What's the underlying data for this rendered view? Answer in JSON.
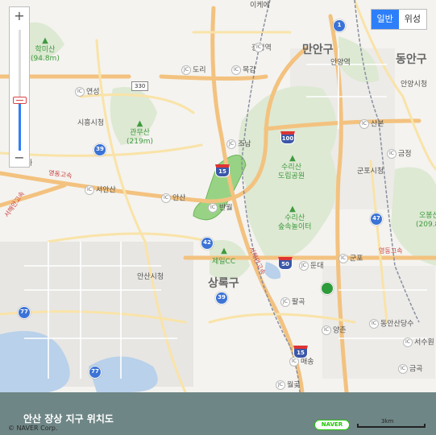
{
  "map_labels": {
    "district_large": [
      "만안구",
      "동안구",
      "상록구"
    ],
    "peaks": [
      {
        "name": "학미산",
        "elev": "(94.8m)"
      },
      {
        "name": "관무산",
        "elev": "(219m)"
      },
      {
        "name": "오봉산",
        "elev": "(209.8)"
      }
    ],
    "parks": [
      "수리산\n도립공원",
      "수리산\n숲속놀이터",
      "제일CC"
    ],
    "places": [
      "이케에",
      "광명역",
      "안양역",
      "안양시청",
      "시흥시청",
      "군포시청",
      "안산시청",
      "산본",
      "금정",
      "당정",
      "목감",
      "조남",
      "도리",
      "연성",
      "서안산",
      "안산",
      "반월",
      "군포",
      "둔대",
      "팔곡",
      "양촌",
      "동안산당수",
      "서수원",
      "금곡",
      "매송",
      "월곶"
    ],
    "ic_labels": [
      "IC 광명역",
      "JC 도리",
      "IC 목감",
      "IC 연성",
      "JC 조남",
      "IC 서안산",
      "IC 안산",
      "IC 산본",
      "IC 금정",
      "JC 둔대",
      "IC 군포",
      "JC 팔곡",
      "IC 양촌",
      "IC 동안산당수",
      "IC 서수원",
      "IC 금곡",
      "IC 매송",
      "JC 월곶"
    ],
    "road_text": [
      "영동고속",
      "영동고속",
      "서해안고속",
      "서해안고속"
    ],
    "shields": [
      "1",
      "39",
      "42",
      "47",
      "39",
      "77",
      "77",
      "330"
    ],
    "hw_shields": [
      "100",
      "15",
      "50",
      "15",
      "15"
    ],
    "letters": [
      "자"
    ]
  },
  "controls": {
    "zoom_in": "+",
    "zoom_out": "−",
    "zoom_level_fraction": 0.42,
    "map_types": [
      "일반",
      "위성"
    ],
    "active_map_type": "일반"
  },
  "caption": {
    "title": "안산 장상 지구 위치도",
    "copyright": "© NAVER Corp.",
    "logo": "NAVER",
    "scale": "3km"
  },
  "colors": {
    "accent": "#2d7ff9",
    "caption_bg": "#6f8686",
    "highlight_zone": "#8fd07a"
  }
}
